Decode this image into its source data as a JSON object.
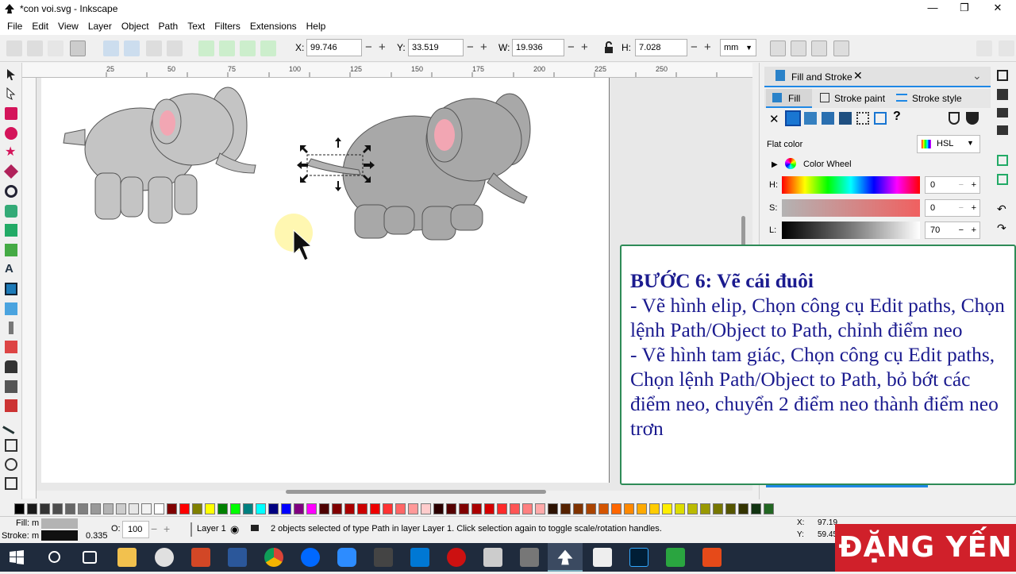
{
  "window": {
    "title": "*con voi.svg - Inkscape",
    "minimize": "—",
    "maximize": "❐",
    "close": "✕"
  },
  "menu": [
    "File",
    "Edit",
    "View",
    "Layer",
    "Object",
    "Path",
    "Text",
    "Filters",
    "Extensions",
    "Help"
  ],
  "toolbar": {
    "x_label": "X:",
    "x_value": "99.746",
    "y_label": "Y:",
    "y_value": "33.519",
    "w_label": "W:",
    "w_value": "19.936",
    "h_label": "H:",
    "h_value": "7.028",
    "unit": "mm"
  },
  "ruler": {
    "ticks": [
      "25",
      "50",
      "75",
      "100",
      "125",
      "150",
      "175",
      "200",
      "225",
      "250"
    ]
  },
  "panel": {
    "tab_title": "Fill and Stroke",
    "tabs": [
      "Fill",
      "Stroke paint",
      "Stroke style"
    ],
    "flat_color": "Flat color",
    "mode": "HSL",
    "color_wheel": "Color Wheel",
    "h_label": "H:",
    "h_value": "0",
    "s_label": "S:",
    "s_value": "0",
    "l_label": "L:",
    "l_value": "70"
  },
  "instructions": {
    "heading": "BƯỚC 6: Vẽ cái đuôi",
    "line1": "- Vẽ hình elip, Chọn công cụ Edit paths, Chọn lệnh Path/Object to Path, chỉnh điểm neo",
    "line2": "- Vẽ hình tam giác, Chọn công cụ Edit paths, Chọn lệnh Path/Object to Path, bỏ bớt các điểm neo, chuyển 2 điểm neo thành điểm neo trơn"
  },
  "status": {
    "fill_label": "Fill:",
    "fill_value": "m",
    "stroke_label": "Stroke:",
    "stroke_value": "m",
    "stroke_width": "0.335",
    "opacity_label": "O:",
    "opacity_value": "100",
    "layer": "Layer 1",
    "message": "2 objects selected of type Path in layer Layer 1. Click selection again to toggle scale/rotation handles.",
    "coord_x_label": "X:",
    "coord_x": "97.19",
    "coord_y_label": "Y:",
    "coord_y": "59.45"
  },
  "branding": "ĐẶNG YẾN",
  "colors": {
    "accent": "#1b1b8f",
    "brand": "#d0202a",
    "frame": "#2e8b57",
    "selected_fill": "#b3b3b3"
  }
}
